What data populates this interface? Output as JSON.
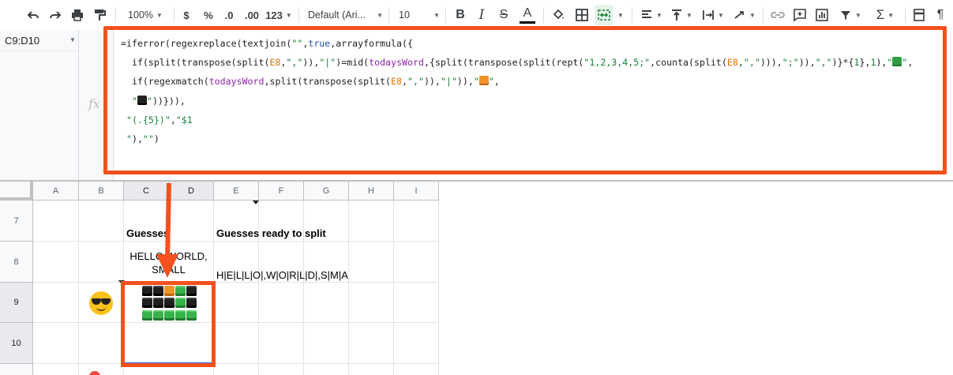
{
  "toolbar": {
    "undo_icon": "undo-icon",
    "redo_icon": "redo-icon",
    "print_icon": "print-icon",
    "paint_format_icon": "paint-format-icon",
    "zoom": "100%",
    "currency": "$",
    "percent": "%",
    "decrease_decimal": ".0",
    "increase_decimal": ".00",
    "more_formats": "123",
    "font_family": "Default (Ari...",
    "font_size": "10",
    "bold_label": "B",
    "italic_label": "I",
    "strike_label": "S",
    "text_color_label": "A",
    "pilcrow": "¶"
  },
  "formula_bar": {
    "name_box": "C9:D10",
    "fx_label": "fx",
    "lines": [
      [
        {
          "t": "=iferror(regexreplace(textjoin("
        },
        {
          "c": "s",
          "t": "\"\""
        },
        {
          "t": ","
        },
        {
          "c": "b",
          "t": "true"
        },
        {
          "t": ",arrayformula({"
        }
      ],
      [
        {
          "t": "  if(split(transpose(split("
        },
        {
          "c": "r",
          "t": "E8"
        },
        {
          "t": ","
        },
        {
          "c": "s",
          "t": "\",\""
        },
        {
          "t": ")),"
        },
        {
          "c": "s",
          "t": "\"|\""
        },
        {
          "t": ")=mid("
        },
        {
          "c": "p",
          "t": "todaysWord"
        },
        {
          "t": ",{split(transpose(split(rept("
        },
        {
          "c": "s",
          "t": "\"1,2,3,4,5;\""
        },
        {
          "t": ",counta(split("
        },
        {
          "c": "r",
          "t": "E8"
        },
        {
          "t": ","
        },
        {
          "c": "s",
          "t": "\",\""
        },
        {
          "t": "))),"
        },
        {
          "c": "s",
          "t": "\";\""
        },
        {
          "t": ")),"
        },
        {
          "c": "s",
          "t": "\",\""
        },
        {
          "t": ")}*{"
        },
        {
          "c": "s",
          "t": "1"
        },
        {
          "t": "},"
        },
        {
          "c": "s",
          "t": "1"
        },
        {
          "t": "),"
        },
        {
          "c": "s",
          "t": "\""
        },
        {
          "blk": "g"
        },
        {
          "c": "s",
          "t": "\""
        },
        {
          "t": ","
        }
      ],
      [
        {
          "t": "  if(regexmatch("
        },
        {
          "c": "p",
          "t": "todaysWord"
        },
        {
          "t": ",split(transpose(split("
        },
        {
          "c": "r",
          "t": "E8"
        },
        {
          "t": ","
        },
        {
          "c": "s",
          "t": "\",\""
        },
        {
          "t": ")),"
        },
        {
          "c": "s",
          "t": "\"|\""
        },
        {
          "t": ")),"
        },
        {
          "c": "s",
          "t": "\""
        },
        {
          "blk": "o"
        },
        {
          "c": "s",
          "t": "\""
        },
        {
          "t": ","
        }
      ],
      [
        {
          "c": "s",
          "t": "  \""
        },
        {
          "blk": "k"
        },
        {
          "c": "s",
          "t": "\""
        },
        {
          "t": "))})),"
        }
      ],
      [
        {
          "c": "s",
          "t": " \"(.{5})\""
        },
        {
          "t": ","
        },
        {
          "c": "s",
          "t": "\"$1"
        }
      ],
      [
        {
          "c": "s",
          "t": " \""
        },
        {
          "t": "),"
        },
        {
          "c": "s",
          "t": "\"\""
        },
        {
          "t": ")"
        }
      ]
    ]
  },
  "grid": {
    "columns": [
      "A",
      "B",
      "C",
      "D",
      "E",
      "F",
      "G",
      "H",
      "I"
    ],
    "rows": [
      "7",
      "8",
      "9",
      "10"
    ],
    "c7": "Guesses",
    "e7": "Guesses ready to split",
    "c8": "HELLO,WORLD,\nSMALL",
    "e8": "H|E|L|L|O|,W|O|R|L|D|,S|M|A",
    "b9_emoji": "smiling-face-with-sunglasses",
    "c9_result": [
      [
        "k",
        "k",
        "o",
        "g",
        "k"
      ],
      [
        "k",
        "k",
        "k",
        "g",
        "k"
      ],
      [
        "g",
        "g",
        "g",
        "g",
        "g"
      ]
    ],
    "annotation_color": "#f4511e",
    "selection_color": "#1a73e8"
  }
}
